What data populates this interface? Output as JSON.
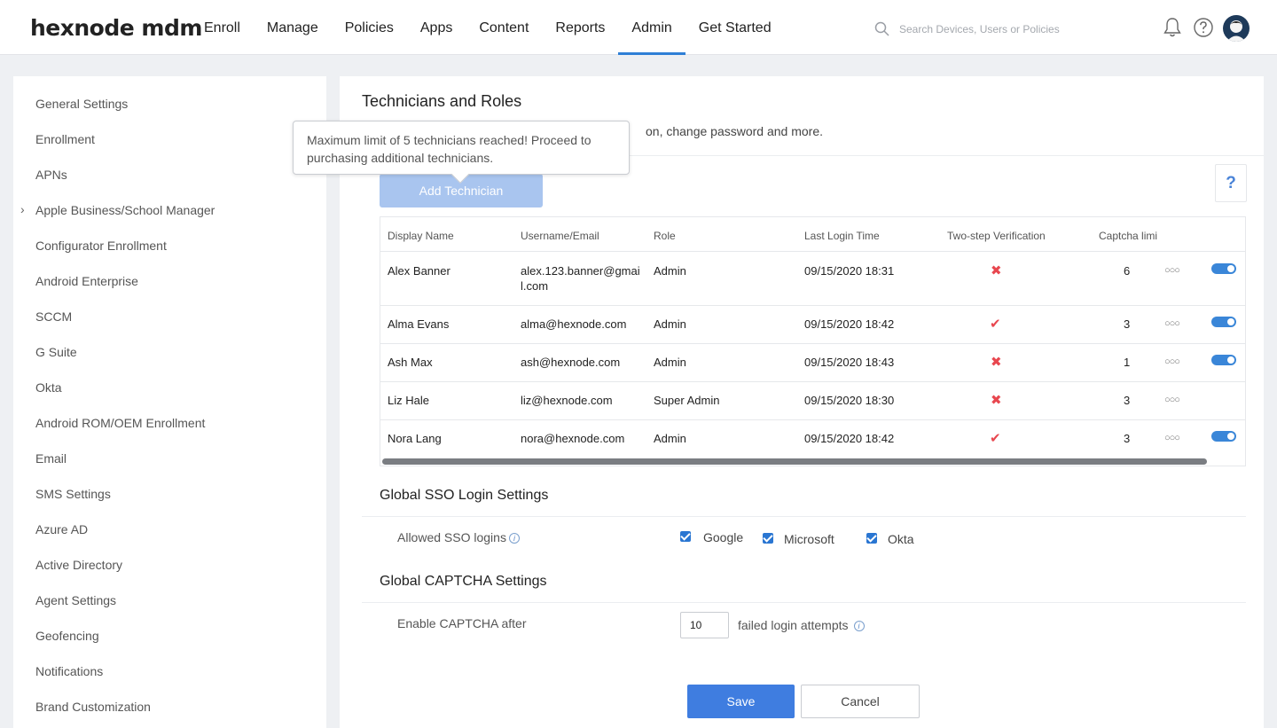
{
  "brand": "hexnode mdm",
  "nav": [
    {
      "label": "Enroll"
    },
    {
      "label": "Manage"
    },
    {
      "label": "Policies"
    },
    {
      "label": "Apps"
    },
    {
      "label": "Content"
    },
    {
      "label": "Reports"
    },
    {
      "label": "Admin",
      "active": true
    },
    {
      "label": "Get Started"
    }
  ],
  "search": {
    "placeholder": "Search Devices, Users or Policies"
  },
  "sidebar": {
    "items": [
      {
        "label": "General Settings"
      },
      {
        "label": "Enrollment"
      },
      {
        "label": "APNs"
      },
      {
        "label": "Apple Business/School Manager"
      },
      {
        "label": "Configurator Enrollment"
      },
      {
        "label": "Android Enterprise"
      },
      {
        "label": "SCCM"
      },
      {
        "label": "G Suite"
      },
      {
        "label": "Okta"
      },
      {
        "label": "Android ROM/OEM Enrollment"
      },
      {
        "label": "Email"
      },
      {
        "label": "SMS Settings"
      },
      {
        "label": "Azure AD"
      },
      {
        "label": "Active Directory"
      },
      {
        "label": "Agent Settings"
      },
      {
        "label": "Geofencing"
      },
      {
        "label": "Notifications"
      },
      {
        "label": "Brand Customization"
      }
    ]
  },
  "main": {
    "title": "Technicians and Roles",
    "description_visible": "on, change password and more.",
    "tooltip": "Maximum limit of 5 technicians reached! Proceed to purchasing additional technicians.",
    "add_button": "Add Technician",
    "help": "?",
    "table": {
      "headers": [
        "Display Name",
        "Username/Email",
        "Role",
        "Last Login Time",
        "Two-step Verification",
        "Captcha limi"
      ],
      "rows": [
        {
          "name": "Alex Banner",
          "email_line1": "alex.123.banner@gmai",
          "email_line2": "l.com",
          "role": "Admin",
          "last_login": "09/15/2020 18:31",
          "two_step": false,
          "captcha": "6",
          "toggle": true
        },
        {
          "name": "Alma Evans",
          "email_line1": "alma@hexnode.com",
          "email_line2": "",
          "role": "Admin",
          "last_login": "09/15/2020 18:42",
          "two_step": true,
          "captcha": "3",
          "toggle": true
        },
        {
          "name": "Ash Max",
          "email_line1": "ash@hexnode.com",
          "email_line2": "",
          "role": "Admin",
          "last_login": "09/15/2020 18:43",
          "two_step": false,
          "captcha": "1",
          "toggle": true
        },
        {
          "name": "Liz Hale",
          "email_line1": "liz@hexnode.com",
          "email_line2": "",
          "role": "Super Admin",
          "last_login": "09/15/2020 18:30",
          "two_step": false,
          "captcha": "3",
          "toggle": false
        },
        {
          "name": "Nora Lang",
          "email_line1": "nora@hexnode.com",
          "email_line2": "",
          "role": "Admin",
          "last_login": "09/15/2020 18:42",
          "two_step": true,
          "captcha": "3",
          "toggle": true
        }
      ]
    },
    "sso": {
      "title": "Global SSO Login Settings",
      "label": "Allowed SSO logins",
      "options": [
        {
          "label": "Google",
          "checked": true
        },
        {
          "label": "Microsoft",
          "checked": true
        },
        {
          "label": "Okta",
          "checked": true
        }
      ]
    },
    "captcha": {
      "title": "Global CAPTCHA Settings",
      "label": "Enable CAPTCHA after",
      "value": "10",
      "suffix": "failed login attempts"
    },
    "save": "Save",
    "cancel": "Cancel"
  },
  "colors": {
    "accent": "#3f7de0",
    "error": "#e8474f",
    "disabled_button": "#a9c5ef"
  }
}
